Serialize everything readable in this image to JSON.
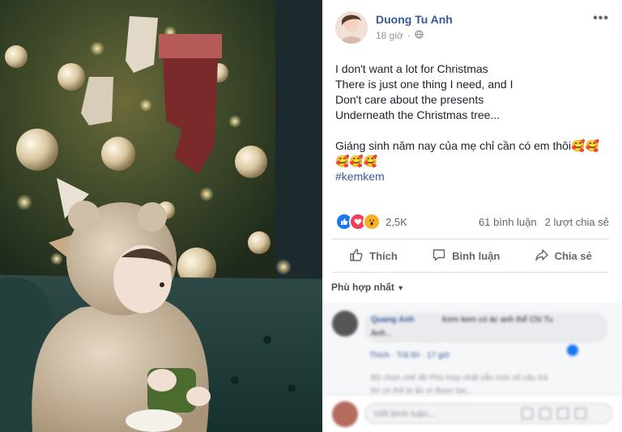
{
  "post": {
    "author": "Duong Tu Anh",
    "time": "18 giờ",
    "privacy_icon": "globe-icon",
    "lines": [
      "I don't want a lot for Christmas",
      "There is just one thing I need, and I",
      "Don't care about the presents",
      "Underneath the Christmas tree...",
      "",
      "Giáng sinh năm nay của mẹ chỉ cần có em thôi🥰🥰",
      "🥰🥰🥰"
    ],
    "hashtag": "#kemkem"
  },
  "stats": {
    "reaction_icons": [
      "like-icon",
      "love-icon",
      "wow-icon"
    ],
    "reaction_count": "2,5K",
    "comments": "61 bình luận",
    "shares": "2 lượt chia sẻ"
  },
  "actions": {
    "like": "Thích",
    "comment": "Bình luận",
    "share": "Chia sẻ"
  },
  "sort_label": "Phù hợp nhất",
  "comment": {
    "name": "Quang Anh",
    "text": "Kem kem có ác anh thể Chi Tu",
    "text2": "Anh...",
    "links": "Thích · Trả lời · 17 giờ",
    "note": "Bộ chọn chế độ Phù hợp nhất vẫn mới số câu trả",
    "note2": "lời có thể bị ẩn vì được lọc..."
  },
  "composer": {
    "placeholder": "Viết bình luận..."
  },
  "colors": {
    "link": "#385898",
    "like": "#1877f2",
    "love": "#f33e58",
    "wow": "#f7b125"
  }
}
